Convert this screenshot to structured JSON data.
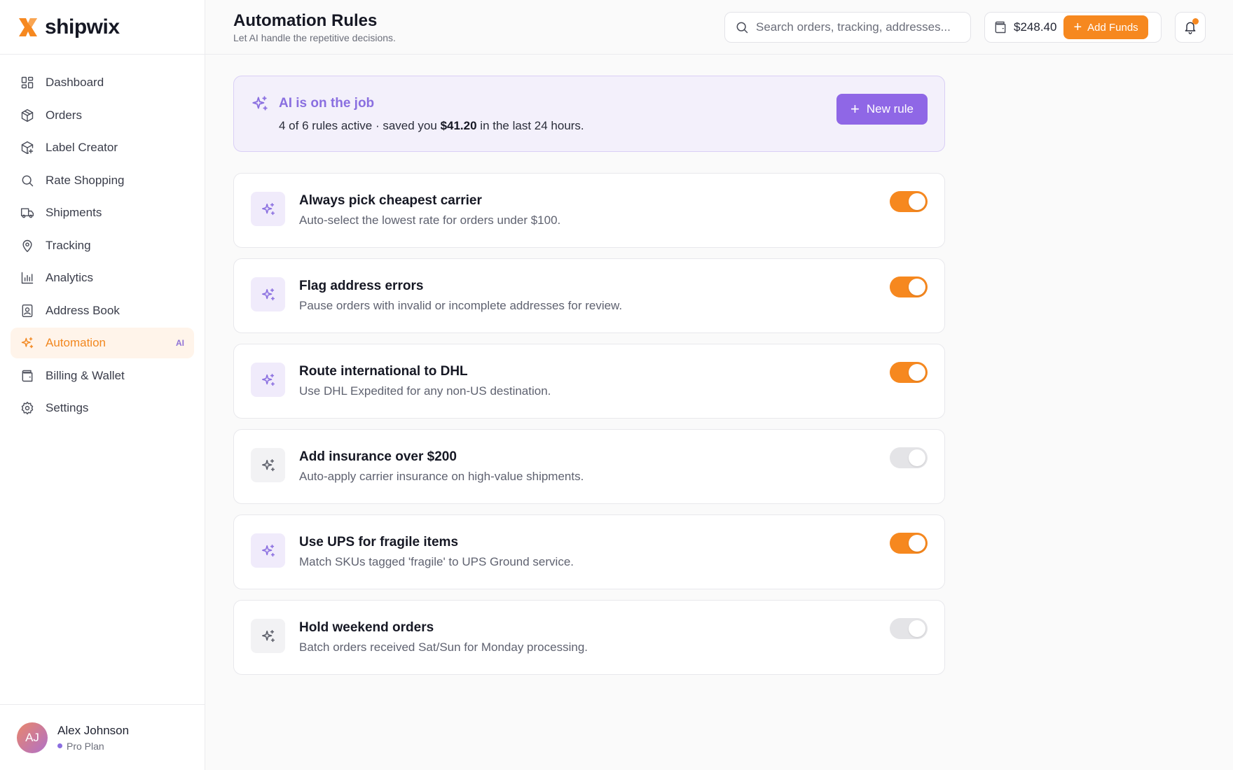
{
  "brand": {
    "name": "shipwix"
  },
  "sidebar": {
    "items": [
      {
        "label": "Dashboard"
      },
      {
        "label": "Orders"
      },
      {
        "label": "Label Creator"
      },
      {
        "label": "Rate Shopping"
      },
      {
        "label": "Shipments"
      },
      {
        "label": "Tracking"
      },
      {
        "label": "Analytics"
      },
      {
        "label": "Address Book"
      },
      {
        "label": "Automation",
        "badge": "AI",
        "active": true
      },
      {
        "label": "Billing & Wallet"
      },
      {
        "label": "Settings"
      }
    ]
  },
  "user": {
    "initials": "AJ",
    "name": "Alex Johnson",
    "plan": "Pro Plan"
  },
  "header": {
    "title": "Automation Rules",
    "subtitle": "Let AI handle the repetitive decisions.",
    "search_placeholder": "Search orders, tracking, addresses...",
    "wallet_balance": "$248.40",
    "add_funds_label": "Add Funds"
  },
  "banner": {
    "title": "AI is on the job",
    "text_prefix": "4 of 6 rules active · saved you ",
    "text_amount": "$41.20",
    "text_suffix": " in the last 24 hours.",
    "new_rule_label": "New rule"
  },
  "rules": [
    {
      "title": "Always pick cheapest carrier",
      "description": "Auto-select the lowest rate for orders under $100.",
      "enabled": true
    },
    {
      "title": "Flag address errors",
      "description": "Pause orders with invalid or incomplete addresses for review.",
      "enabled": true
    },
    {
      "title": "Route international to DHL",
      "description": "Use DHL Expedited for any non-US destination.",
      "enabled": true
    },
    {
      "title": "Add insurance over $200",
      "description": "Auto-apply carrier insurance on high-value shipments.",
      "enabled": false
    },
    {
      "title": "Use UPS for fragile items",
      "description": "Match SKUs tagged 'fragile' to UPS Ground service.",
      "enabled": true
    },
    {
      "title": "Hold weekend orders",
      "description": "Batch orders received Sat/Sun for Monday processing.",
      "enabled": false
    }
  ],
  "icons": {
    "logo": "shipwix-logo-icon",
    "sparkle": "sparkle-icon",
    "search": "search-icon",
    "wallet": "wallet-icon",
    "bell": "bell-icon"
  },
  "colors": {
    "accent_orange": "#f6881f",
    "accent_purple": "#8f67e6",
    "toggle_off": "#e4e4e7"
  }
}
